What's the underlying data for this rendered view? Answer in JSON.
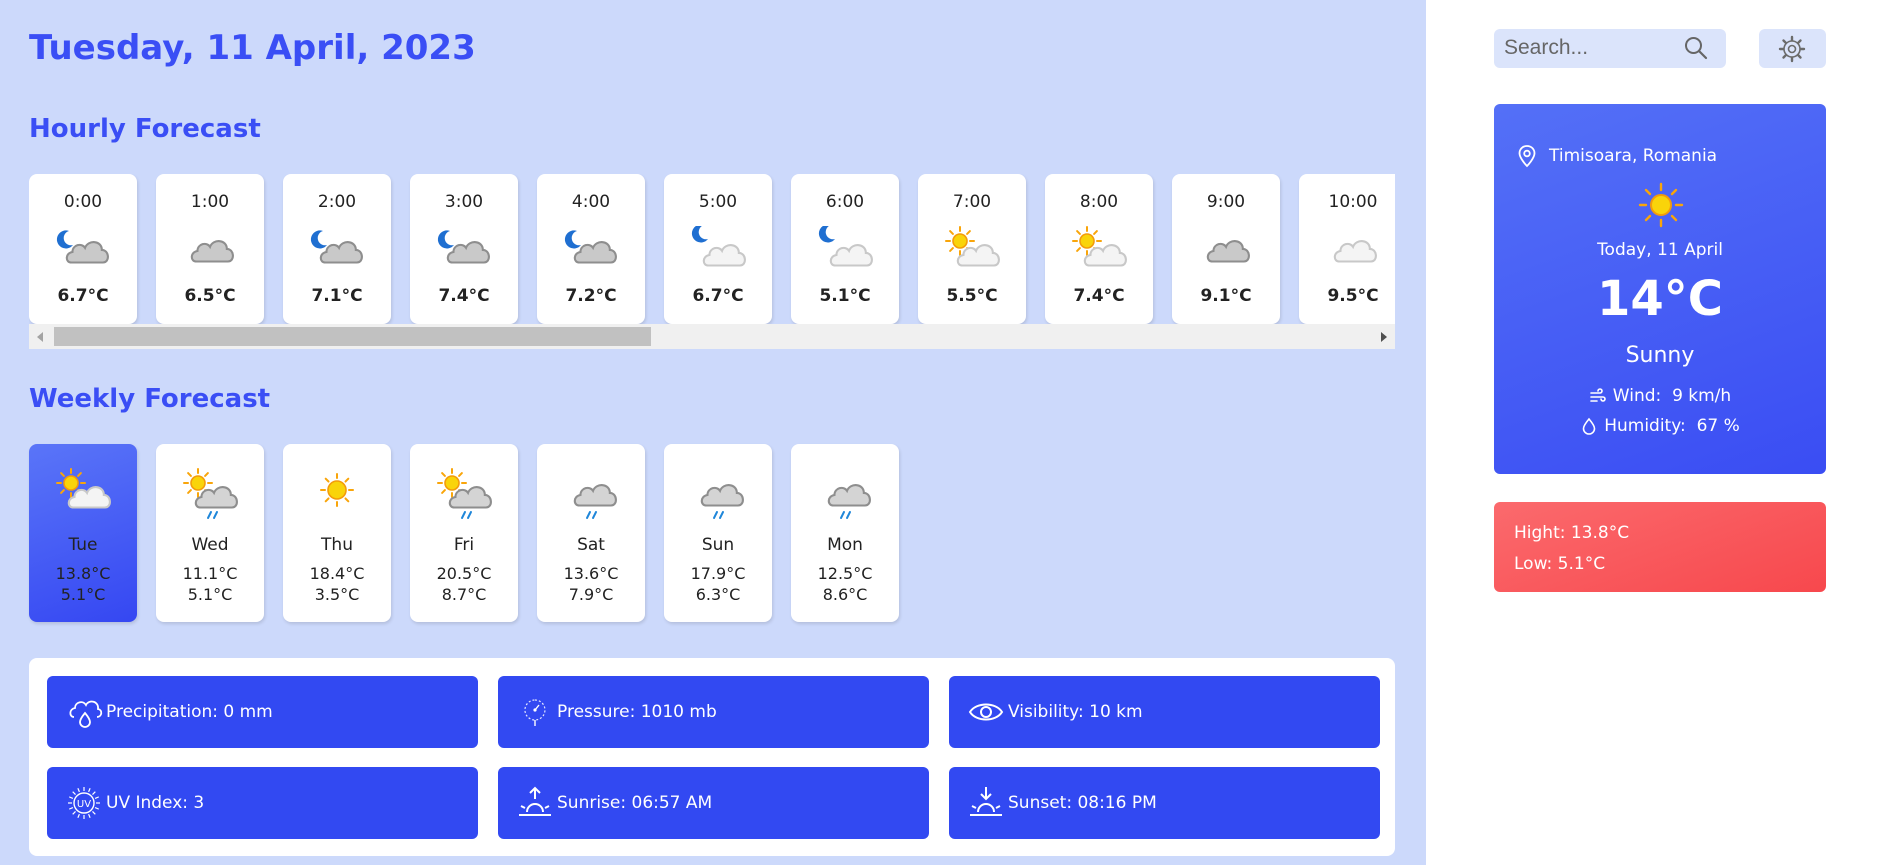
{
  "header": {
    "date": "Tuesday, 11 April, 2023"
  },
  "sections": {
    "hourly_title": "Hourly Forecast",
    "weekly_title": "Weekly Forecast"
  },
  "hourly": [
    {
      "time": "0:00",
      "temp": "6.7°C",
      "icon": "cloudy-night-icon"
    },
    {
      "time": "1:00",
      "temp": "6.5°C",
      "icon": "cloud-icon"
    },
    {
      "time": "2:00",
      "temp": "7.1°C",
      "icon": "cloudy-night-icon"
    },
    {
      "time": "3:00",
      "temp": "7.4°C",
      "icon": "cloudy-night-icon"
    },
    {
      "time": "4:00",
      "temp": "7.2°C",
      "icon": "cloudy-night-icon"
    },
    {
      "time": "5:00",
      "temp": "6.7°C",
      "icon": "partly-cloudy-night-icon"
    },
    {
      "time": "6:00",
      "temp": "5.1°C",
      "icon": "partly-cloudy-night-icon"
    },
    {
      "time": "7:00",
      "temp": "5.5°C",
      "icon": "partly-cloudy-day-icon"
    },
    {
      "time": "8:00",
      "temp": "7.4°C",
      "icon": "partly-cloudy-day-icon"
    },
    {
      "time": "9:00",
      "temp": "9.1°C",
      "icon": "cloud-icon"
    },
    {
      "time": "10:00",
      "temp": "9.5°C",
      "icon": "light-cloud-icon"
    }
  ],
  "weekly": [
    {
      "day": "Tue",
      "high": "13.8°C",
      "low": "5.1°C",
      "icon": "partly-cloudy-day-icon",
      "active": true
    },
    {
      "day": "Wed",
      "high": "11.1°C",
      "low": "5.1°C",
      "icon": "sun-cloud-rain-icon"
    },
    {
      "day": "Thu",
      "high": "18.4°C",
      "low": "3.5°C",
      "icon": "sun-icon"
    },
    {
      "day": "Fri",
      "high": "20.5°C",
      "low": "8.7°C",
      "icon": "sun-cloud-rain-icon"
    },
    {
      "day": "Sat",
      "high": "13.6°C",
      "low": "7.9°C",
      "icon": "cloud-rain-icon"
    },
    {
      "day": "Sun",
      "high": "17.9°C",
      "low": "6.3°C",
      "icon": "cloud-rain-icon"
    },
    {
      "day": "Mon",
      "high": "12.5°C",
      "low": "8.6°C",
      "icon": "cloud-rain-icon"
    }
  ],
  "details": [
    {
      "text": "Precipitation: 0 mm",
      "icon": "precipitation-icon"
    },
    {
      "text": "Pressure: 1010 mb",
      "icon": "pressure-icon"
    },
    {
      "text": "Visibility: 10 km",
      "icon": "eye-icon"
    },
    {
      "text": "UV Index: 3",
      "icon": "uv-index-icon"
    },
    {
      "text": "Sunrise: 06:57 AM",
      "icon": "sunrise-icon"
    },
    {
      "text": "Sunset: 08:16 PM",
      "icon": "sunset-icon"
    }
  ],
  "search": {
    "placeholder": "Search..."
  },
  "current": {
    "location": "Timisoara, Romania",
    "date": "Today, 11 April",
    "temp": "14°C",
    "condition": "Sunny",
    "wind_label": "Wind:",
    "wind_value": "9 km/h",
    "humidity_label": "Humidity:",
    "humidity_value": "67 %",
    "icon": "sun-icon"
  },
  "highlow": {
    "high": "Hight: 13.8°C",
    "low": "Low: 5.1°C"
  },
  "colors": {
    "accent": "#3a4ef5",
    "page_background": "#ccd9fb",
    "tile_blue": "#3249f2",
    "highlow_red": "#f7484d",
    "sun": "#f9c20a",
    "moon": "#1f6fd1"
  }
}
